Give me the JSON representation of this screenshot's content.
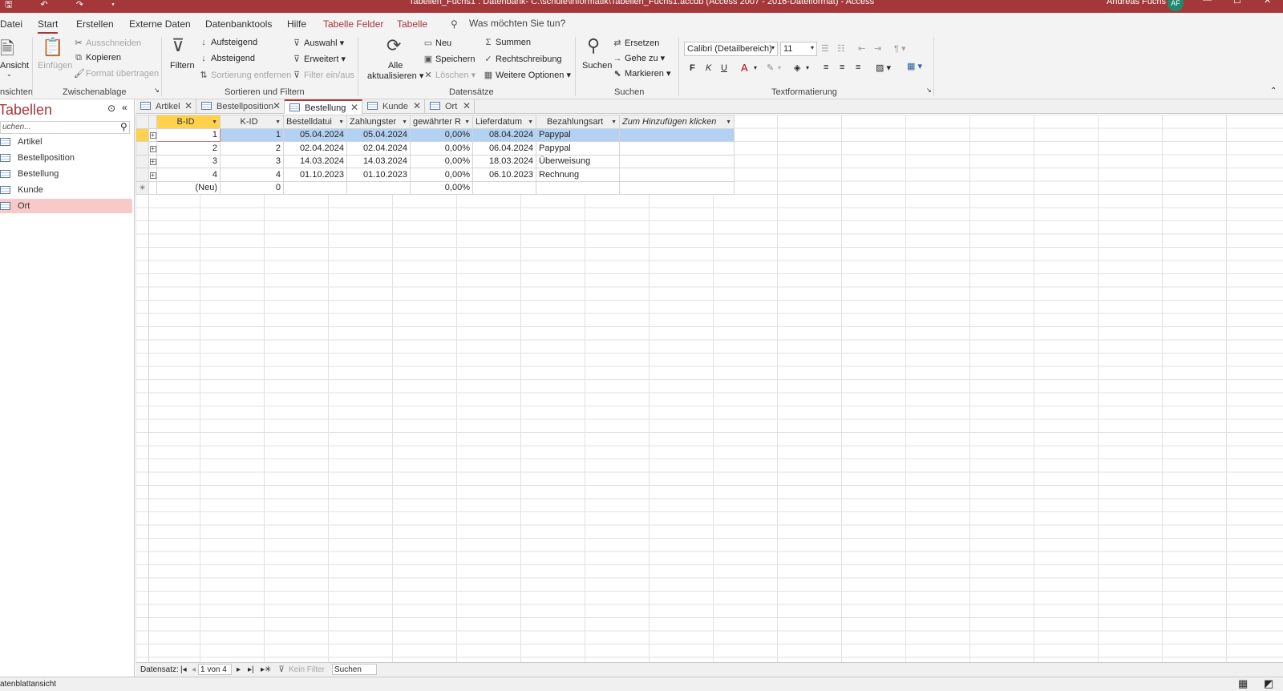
{
  "titlebar": {
    "title": "Tabellen_Fuchs1 : Datenbank- C:\\schule\\informatik\\Tabellen_Fuchs1.accdb (Access 2007 - 2016-Dateiformat)  -  Access",
    "user": "Andreas Fuchs",
    "avatar": "AF",
    "min": "—",
    "max": "☐",
    "close": "✕"
  },
  "ribbon_tabs": [
    "Datei",
    "Start",
    "Erstellen",
    "Externe Daten",
    "Datenbanktools",
    "Hilfe",
    "Tabelle Felder",
    "Tabelle"
  ],
  "tellme": "Was möchten Sie tun?",
  "ribbon": {
    "ansicht": "Ansicht",
    "einfuegen": "Einfügen",
    "ausschneiden": "Ausschneiden",
    "kopieren": "Kopieren",
    "format": "Format übertragen",
    "filtern": "Filtern",
    "aufsteigend": "Aufsteigend",
    "absteigend": "Absteigend",
    "sortierung_entfernen": "Sortierung entfernen",
    "auswahl": "Auswahl",
    "erweitert": "Erweitert",
    "filter_einaus": "Filter ein/aus",
    "alle": "Alle",
    "aktualisieren": "aktualisieren",
    "neu": "Neu",
    "speichern": "Speichern",
    "loeschen": "Löschen",
    "summen": "Summen",
    "rechtschreibung": "Rechtschreibung",
    "weitere": "Weitere Optionen",
    "suchen": "Suchen",
    "ersetzen": "Ersetzen",
    "gehe_zu": "Gehe zu",
    "markieren": "Markieren",
    "font": "Calibri (Detailbereich)",
    "size": "11",
    "groups": {
      "ansichten": "nsichten",
      "zwischenablage": "Zwischenablage",
      "sortieren": "Sortieren und Filtern",
      "datensaetze": "Datensätze",
      "suchen": "Suchen",
      "text": "Textformatierung"
    }
  },
  "nav": {
    "title": "Tabellen",
    "search_placeholder": "uchen...",
    "items": [
      "Artikel",
      "Bestellposition",
      "Bestellung",
      "Kunde",
      "Ort"
    ]
  },
  "doc_tabs": [
    "Artikel",
    "Bestellposition",
    "Bestellung",
    "Kunde",
    "Ort"
  ],
  "table": {
    "columns": [
      "B-ID",
      "K-ID",
      "Bestelldatui",
      "Zahlungster",
      "gewährter R",
      "Lieferdatum",
      "Bezahlungsart",
      "Zum Hinzufügen klicken"
    ],
    "rows": [
      [
        "1",
        "1",
        "05.04.2024",
        "05.04.2024",
        "0,00%",
        "08.04.2024",
        "Papypal"
      ],
      [
        "2",
        "2",
        "02.04.2024",
        "02.04.2024",
        "0,00%",
        "06.04.2024",
        "Papypal"
      ],
      [
        "3",
        "3",
        "14.03.2024",
        "14.03.2024",
        "0,00%",
        "18.03.2024",
        "Überweisung"
      ],
      [
        "4",
        "4",
        "01.10.2023",
        "01.10.2023",
        "0,00%",
        "06.10.2023",
        "Rechnung"
      ]
    ],
    "new_row": [
      "(Neu)",
      "0",
      "",
      "",
      "0,00%",
      "",
      ""
    ]
  },
  "record_nav": {
    "label": "Datensatz:",
    "position": "1 von 4",
    "filter": "Kein Filter",
    "search": "Suchen"
  },
  "status": {
    "text": "atenblattansicht"
  }
}
